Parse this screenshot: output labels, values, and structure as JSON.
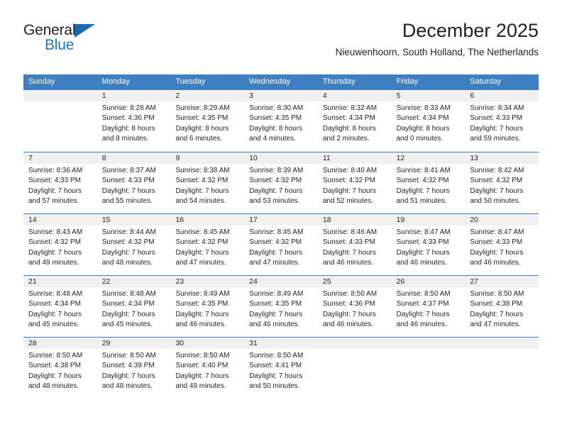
{
  "logo": {
    "text_top": "General",
    "text_bottom": "Blue",
    "triangle_color": "#156bb1",
    "blue_color": "#1b75bc"
  },
  "header": {
    "title": "December 2025",
    "subtitle": "Nieuwenhoorn, South Holland, The Netherlands"
  },
  "theme": {
    "header_blue": "#3d7fc1",
    "day_band_gray": "#f0f0f0",
    "text_color": "#231f20"
  },
  "calendar": {
    "weekdays": [
      "Sunday",
      "Monday",
      "Tuesday",
      "Wednesday",
      "Thursday",
      "Friday",
      "Saturday"
    ],
    "weeks": [
      [
        {
          "day": "",
          "lines": []
        },
        {
          "day": "1",
          "lines": [
            "Sunrise: 8:28 AM",
            "Sunset: 4:36 PM",
            "Daylight: 8 hours",
            "and 8 minutes."
          ]
        },
        {
          "day": "2",
          "lines": [
            "Sunrise: 8:29 AM",
            "Sunset: 4:35 PM",
            "Daylight: 8 hours",
            "and 6 minutes."
          ]
        },
        {
          "day": "3",
          "lines": [
            "Sunrise: 8:30 AM",
            "Sunset: 4:35 PM",
            "Daylight: 8 hours",
            "and 4 minutes."
          ]
        },
        {
          "day": "4",
          "lines": [
            "Sunrise: 8:32 AM",
            "Sunset: 4:34 PM",
            "Daylight: 8 hours",
            "and 2 minutes."
          ]
        },
        {
          "day": "5",
          "lines": [
            "Sunrise: 8:33 AM",
            "Sunset: 4:34 PM",
            "Daylight: 8 hours",
            "and 0 minutes."
          ]
        },
        {
          "day": "6",
          "lines": [
            "Sunrise: 8:34 AM",
            "Sunset: 4:33 PM",
            "Daylight: 7 hours",
            "and 59 minutes."
          ]
        }
      ],
      [
        {
          "day": "7",
          "lines": [
            "Sunrise: 8:36 AM",
            "Sunset: 4:33 PM",
            "Daylight: 7 hours",
            "and 57 minutes."
          ]
        },
        {
          "day": "8",
          "lines": [
            "Sunrise: 8:37 AM",
            "Sunset: 4:33 PM",
            "Daylight: 7 hours",
            "and 55 minutes."
          ]
        },
        {
          "day": "9",
          "lines": [
            "Sunrise: 8:38 AM",
            "Sunset: 4:32 PM",
            "Daylight: 7 hours",
            "and 54 minutes."
          ]
        },
        {
          "day": "10",
          "lines": [
            "Sunrise: 8:39 AM",
            "Sunset: 4:32 PM",
            "Daylight: 7 hours",
            "and 53 minutes."
          ]
        },
        {
          "day": "11",
          "lines": [
            "Sunrise: 8:40 AM",
            "Sunset: 4:32 PM",
            "Daylight: 7 hours",
            "and 52 minutes."
          ]
        },
        {
          "day": "12",
          "lines": [
            "Sunrise: 8:41 AM",
            "Sunset: 4:32 PM",
            "Daylight: 7 hours",
            "and 51 minutes."
          ]
        },
        {
          "day": "13",
          "lines": [
            "Sunrise: 8:42 AM",
            "Sunset: 4:32 PM",
            "Daylight: 7 hours",
            "and 50 minutes."
          ]
        }
      ],
      [
        {
          "day": "14",
          "lines": [
            "Sunrise: 8:43 AM",
            "Sunset: 4:32 PM",
            "Daylight: 7 hours",
            "and 49 minutes."
          ]
        },
        {
          "day": "15",
          "lines": [
            "Sunrise: 8:44 AM",
            "Sunset: 4:32 PM",
            "Daylight: 7 hours",
            "and 48 minutes."
          ]
        },
        {
          "day": "16",
          "lines": [
            "Sunrise: 8:45 AM",
            "Sunset: 4:32 PM",
            "Daylight: 7 hours",
            "and 47 minutes."
          ]
        },
        {
          "day": "17",
          "lines": [
            "Sunrise: 8:45 AM",
            "Sunset: 4:32 PM",
            "Daylight: 7 hours",
            "and 47 minutes."
          ]
        },
        {
          "day": "18",
          "lines": [
            "Sunrise: 8:46 AM",
            "Sunset: 4:33 PM",
            "Daylight: 7 hours",
            "and 46 minutes."
          ]
        },
        {
          "day": "19",
          "lines": [
            "Sunrise: 8:47 AM",
            "Sunset: 4:33 PM",
            "Daylight: 7 hours",
            "and 46 minutes."
          ]
        },
        {
          "day": "20",
          "lines": [
            "Sunrise: 8:47 AM",
            "Sunset: 4:33 PM",
            "Daylight: 7 hours",
            "and 46 minutes."
          ]
        }
      ],
      [
        {
          "day": "21",
          "lines": [
            "Sunrise: 8:48 AM",
            "Sunset: 4:34 PM",
            "Daylight: 7 hours",
            "and 45 minutes."
          ]
        },
        {
          "day": "22",
          "lines": [
            "Sunrise: 8:48 AM",
            "Sunset: 4:34 PM",
            "Daylight: 7 hours",
            "and 45 minutes."
          ]
        },
        {
          "day": "23",
          "lines": [
            "Sunrise: 8:49 AM",
            "Sunset: 4:35 PM",
            "Daylight: 7 hours",
            "and 46 minutes."
          ]
        },
        {
          "day": "24",
          "lines": [
            "Sunrise: 8:49 AM",
            "Sunset: 4:35 PM",
            "Daylight: 7 hours",
            "and 46 minutes."
          ]
        },
        {
          "day": "25",
          "lines": [
            "Sunrise: 8:50 AM",
            "Sunset: 4:36 PM",
            "Daylight: 7 hours",
            "and 46 minutes."
          ]
        },
        {
          "day": "26",
          "lines": [
            "Sunrise: 8:50 AM",
            "Sunset: 4:37 PM",
            "Daylight: 7 hours",
            "and 46 minutes."
          ]
        },
        {
          "day": "27",
          "lines": [
            "Sunrise: 8:50 AM",
            "Sunset: 4:38 PM",
            "Daylight: 7 hours",
            "and 47 minutes."
          ]
        }
      ],
      [
        {
          "day": "28",
          "lines": [
            "Sunrise: 8:50 AM",
            "Sunset: 4:38 PM",
            "Daylight: 7 hours",
            "and 48 minutes."
          ]
        },
        {
          "day": "29",
          "lines": [
            "Sunrise: 8:50 AM",
            "Sunset: 4:39 PM",
            "Daylight: 7 hours",
            "and 48 minutes."
          ]
        },
        {
          "day": "30",
          "lines": [
            "Sunrise: 8:50 AM",
            "Sunset: 4:40 PM",
            "Daylight: 7 hours",
            "and 49 minutes."
          ]
        },
        {
          "day": "31",
          "lines": [
            "Sunrise: 8:50 AM",
            "Sunset: 4:41 PM",
            "Daylight: 7 hours",
            "and 50 minutes."
          ]
        },
        {
          "day": "",
          "lines": []
        },
        {
          "day": "",
          "lines": []
        },
        {
          "day": "",
          "lines": []
        }
      ]
    ]
  }
}
